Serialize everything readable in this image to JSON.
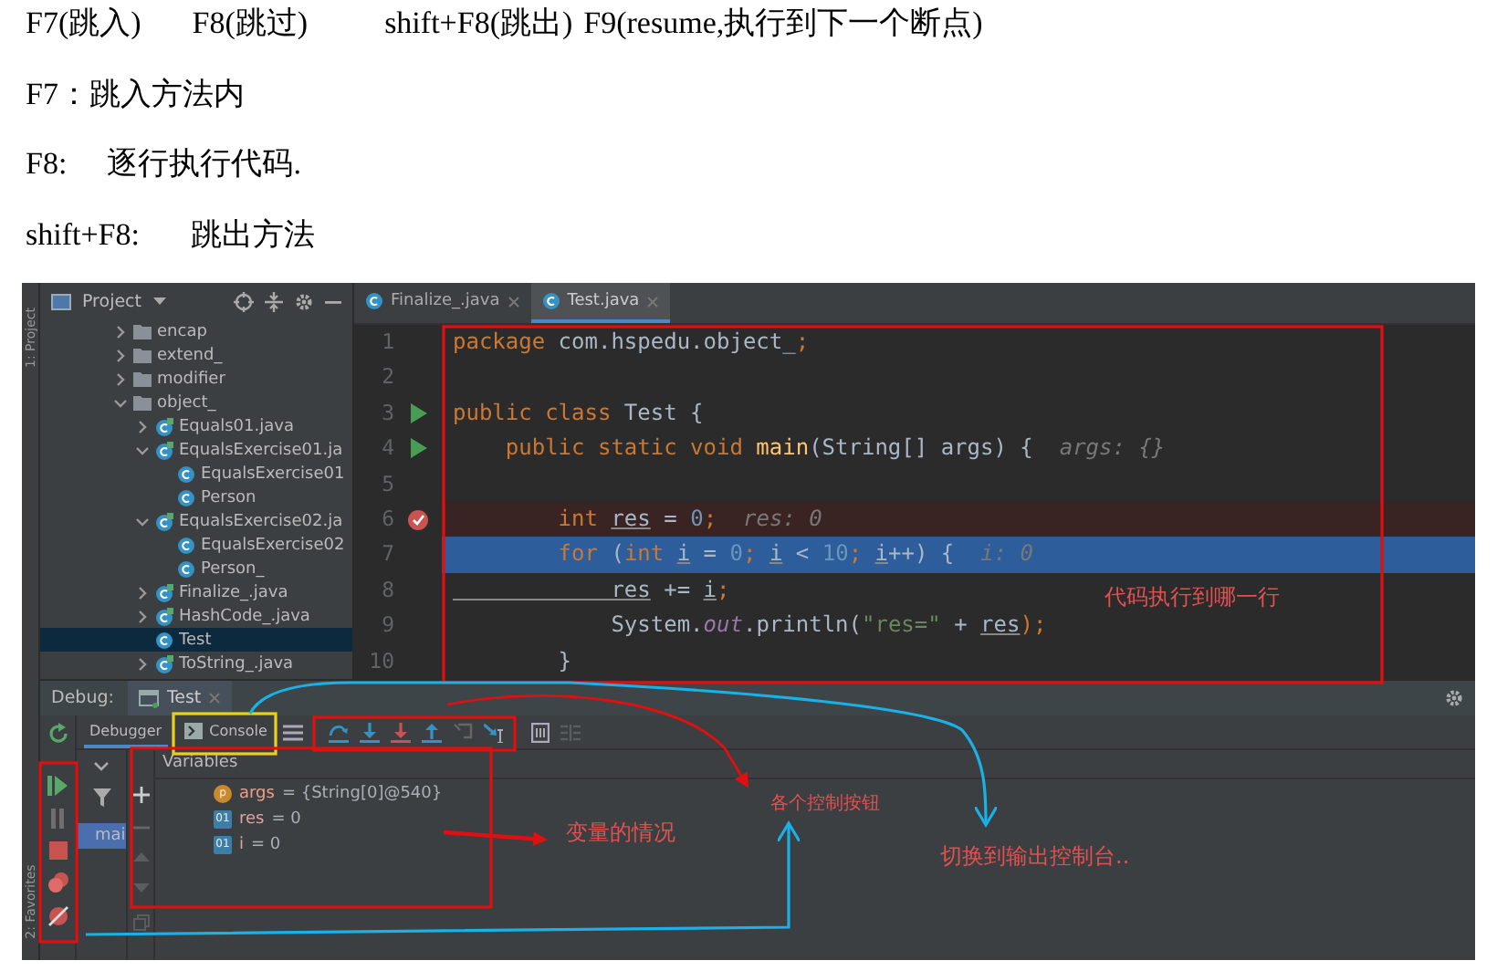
{
  "notes": {
    "shortcuts": [
      "F7(跳入)",
      "F8(跳过)",
      "shift+F8(跳出)",
      "F9(resume,执行到下一个断点)"
    ],
    "items": [
      {
        "key": "F7：",
        "text": "跳入方法内"
      },
      {
        "key": "F8:",
        "text": "逐行执行代码."
      },
      {
        "key": "shift+F8:",
        "text": "跳出方法"
      }
    ]
  },
  "ide": {
    "left_strip": {
      "top": "1: Project",
      "bottom": "2: Favorites"
    },
    "project": {
      "title": "Project",
      "tree": [
        {
          "label": "encap",
          "kind": "folder",
          "expanded": false,
          "selected": false
        },
        {
          "label": "extend_",
          "kind": "folder",
          "expanded": false,
          "selected": false
        },
        {
          "label": "modifier",
          "kind": "folder",
          "expanded": false,
          "selected": false
        },
        {
          "label": "object_",
          "kind": "folder",
          "expanded": true,
          "selected": false,
          "children": [
            {
              "label": "Equals01.java",
              "kind": "file",
              "expanded": false,
              "selected": false
            },
            {
              "label": "EqualsExercise01.ja",
              "kind": "file",
              "expanded": true,
              "selected": false,
              "children": [
                {
                  "label": "EqualsExercise01",
                  "kind": "class",
                  "selected": false
                },
                {
                  "label": "Person",
                  "kind": "class",
                  "selected": false
                }
              ]
            },
            {
              "label": "EqualsExercise02.ja",
              "kind": "file",
              "expanded": true,
              "selected": false,
              "children": [
                {
                  "label": "EqualsExercise02",
                  "kind": "class",
                  "selected": false
                },
                {
                  "label": "Person_",
                  "kind": "class",
                  "selected": false
                }
              ]
            },
            {
              "label": "Finalize_.java",
              "kind": "file",
              "expanded": false,
              "selected": false
            },
            {
              "label": "HashCode_.java",
              "kind": "file",
              "expanded": false,
              "selected": false
            },
            {
              "label": "Test",
              "kind": "class",
              "selected": true
            },
            {
              "label": "ToString_.java",
              "kind": "file",
              "expanded": false,
              "selected": false
            }
          ]
        }
      ]
    },
    "editor": {
      "tabs": [
        {
          "label": "Finalize_.java",
          "selected": false
        },
        {
          "label": "Test.java",
          "selected": true
        }
      ],
      "lines": [
        {
          "number": "1",
          "run_marker": false,
          "breakpoint": false,
          "current": false,
          "tokens": [
            {
              "kind": "kw",
              "text": "package"
            },
            {
              "kind": "id",
              "text": " com.hspedu.object_"
            },
            {
              "kind": "kw",
              "text": ";"
            }
          ]
        },
        {
          "number": "2",
          "run_marker": false,
          "breakpoint": false,
          "current": false
        },
        {
          "number": "3",
          "run_marker": true,
          "breakpoint": false,
          "current": false,
          "tokens": [
            {
              "kind": "kw",
              "text": "public class"
            },
            {
              "kind": "id",
              "text": " Test {"
            }
          ]
        },
        {
          "number": "4",
          "run_marker": true,
          "breakpoint": false,
          "current": false,
          "tokens": [
            {
              "kind": "kw",
              "text": "    public static void "
            },
            {
              "kind": "fn",
              "text": "main"
            },
            {
              "kind": "id",
              "text": "(String[] args) {"
            },
            {
              "kind": "hint",
              "text": "  args: {}"
            }
          ]
        },
        {
          "number": "5",
          "run_marker": false,
          "breakpoint": false,
          "current": false
        },
        {
          "number": "6",
          "run_marker": false,
          "breakpoint": true,
          "current": false,
          "tokens": [
            {
              "kind": "kw",
              "text": "        int "
            },
            {
              "kind": "var",
              "text": "res"
            },
            {
              "kind": "id",
              "text": " = "
            },
            {
              "kind": "num",
              "text": "0"
            },
            {
              "kind": "kw",
              "text": ";"
            },
            {
              "kind": "hint",
              "text": "  res: 0"
            }
          ]
        },
        {
          "number": "7",
          "run_marker": false,
          "breakpoint": false,
          "current": true,
          "tokens": [
            {
              "kind": "kw",
              "text": "        for "
            },
            {
              "kind": "id",
              "text": "("
            },
            {
              "kind": "kw",
              "text": "int "
            },
            {
              "kind": "var",
              "text": "i"
            },
            {
              "kind": "id",
              "text": " = "
            },
            {
              "kind": "num",
              "text": "0"
            },
            {
              "kind": "kw",
              "text": "; "
            },
            {
              "kind": "var",
              "text": "i"
            },
            {
              "kind": "id",
              "text": " < "
            },
            {
              "kind": "num",
              "text": "10"
            },
            {
              "kind": "kw",
              "text": "; "
            },
            {
              "kind": "var",
              "text": "i"
            },
            {
              "kind": "id",
              "text": "++) {"
            },
            {
              "kind": "hint",
              "text": "  i: 0"
            }
          ]
        },
        {
          "number": "8",
          "run_marker": false,
          "breakpoint": false,
          "current": false,
          "tokens": [
            {
              "kind": "var",
              "text": "            res"
            },
            {
              "kind": "id",
              "text": " += "
            },
            {
              "kind": "var",
              "text": "i"
            },
            {
              "kind": "kw",
              "text": ";"
            }
          ]
        },
        {
          "number": "9",
          "run_marker": false,
          "breakpoint": false,
          "current": false,
          "tokens": [
            {
              "kind": "id",
              "text": "            System."
            },
            {
              "kind": "field",
              "text": "out"
            },
            {
              "kind": "id",
              "text": ".println("
            },
            {
              "kind": "str",
              "text": "\"res=\""
            },
            {
              "kind": "id",
              "text": " + "
            },
            {
              "kind": "var",
              "text": "res"
            },
            {
              "kind": "kw",
              "text": ");"
            }
          ]
        },
        {
          "number": "10",
          "run_marker": false,
          "breakpoint": false,
          "current": false,
          "tokens": [
            {
              "kind": "id",
              "text": "        }"
            }
          ]
        }
      ]
    },
    "debug": {
      "title": "Debug:",
      "tab": "Test",
      "subtabs": [
        {
          "label": "Debugger",
          "selected": true
        },
        {
          "label": "Console",
          "selected": false
        }
      ],
      "frames": [
        {
          "label": "mai",
          "selected": true
        }
      ],
      "variables_title": "Variables",
      "variables": [
        {
          "kind": "param",
          "badge": "p",
          "name": "args",
          "value": "= {String[0]@540}"
        },
        {
          "kind": "local",
          "badge": "01",
          "name": "res",
          "value": "= 0"
        },
        {
          "kind": "local",
          "badge": "01",
          "name": "i",
          "value": "= 0"
        }
      ]
    }
  },
  "annotations": [
    {
      "text": "代码执行到哪一行"
    },
    {
      "text": "变量的情况"
    },
    {
      "text": "各个控制按钮"
    },
    {
      "text": "切换到输出控制台.."
    }
  ]
}
